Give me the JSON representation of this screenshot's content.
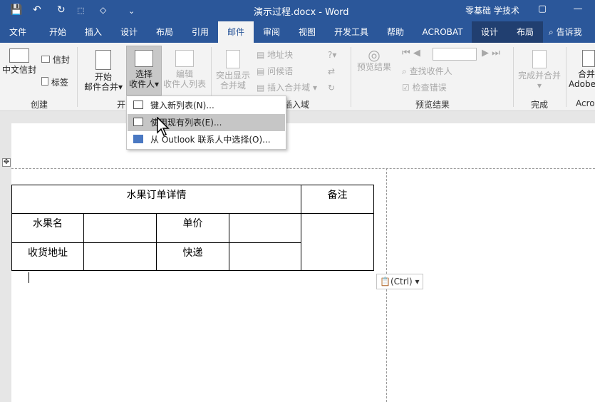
{
  "window": {
    "title": "演示过程.docx  -  Word",
    "user": "零基础 学技术",
    "min_glyph": "—",
    "restore_glyph": "▢"
  },
  "qat": {
    "save": "💾",
    "undo": "↶",
    "redo": "↻",
    "more": "⌄"
  },
  "tabs": [
    {
      "label": "文件"
    },
    {
      "label": "开始"
    },
    {
      "label": "插入"
    },
    {
      "label": "设计"
    },
    {
      "label": "布局"
    },
    {
      "label": "引用"
    },
    {
      "label": "邮件"
    },
    {
      "label": "审阅"
    },
    {
      "label": "视图"
    },
    {
      "label": "开发工具"
    },
    {
      "label": "帮助"
    },
    {
      "label": "ACROBAT"
    },
    {
      "label": "设计"
    },
    {
      "label": "布局"
    }
  ],
  "tell_me": "告诉我",
  "ribbon": {
    "create": {
      "chinese_envelope": "中文信封",
      "envelope": "信封",
      "labels": "标签",
      "group": "创建"
    },
    "start_merge": {
      "start_line1": "开始",
      "start_line2": "邮件合并",
      "select_line1": "选择",
      "select_line2": "收件人",
      "edit_line1": "编辑",
      "edit_line2": "收件人列表",
      "group": "开"
    },
    "fields": {
      "highlight_line1": "突出显示",
      "highlight_line2": "合并域",
      "address_block": "地址块",
      "greeting": "问候语",
      "insert_field": "插入合并域",
      "group": "插入域"
    },
    "preview": {
      "preview_results": "预览结果",
      "find_recipient": "查找收件人",
      "check_errors": "检查错误",
      "group": "预览结果"
    },
    "finish": {
      "finish_merge": "完成并合并",
      "group": "完成"
    },
    "acrobat": {
      "merge_line1": "合并",
      "merge_line2": "Adobe",
      "group": "Acro"
    }
  },
  "dropdown": {
    "items": [
      {
        "label": "键入新列表(N)..."
      },
      {
        "label": "使用现有列表(E)..."
      },
      {
        "label": "从 Outlook 联系人中选择(O)..."
      }
    ]
  },
  "table": {
    "title": "水果订单详情",
    "remark": "备注",
    "fruit": "水果名",
    "price": "单价",
    "address": "收货地址",
    "courier": "快递"
  },
  "paste": "(Ctrl)"
}
